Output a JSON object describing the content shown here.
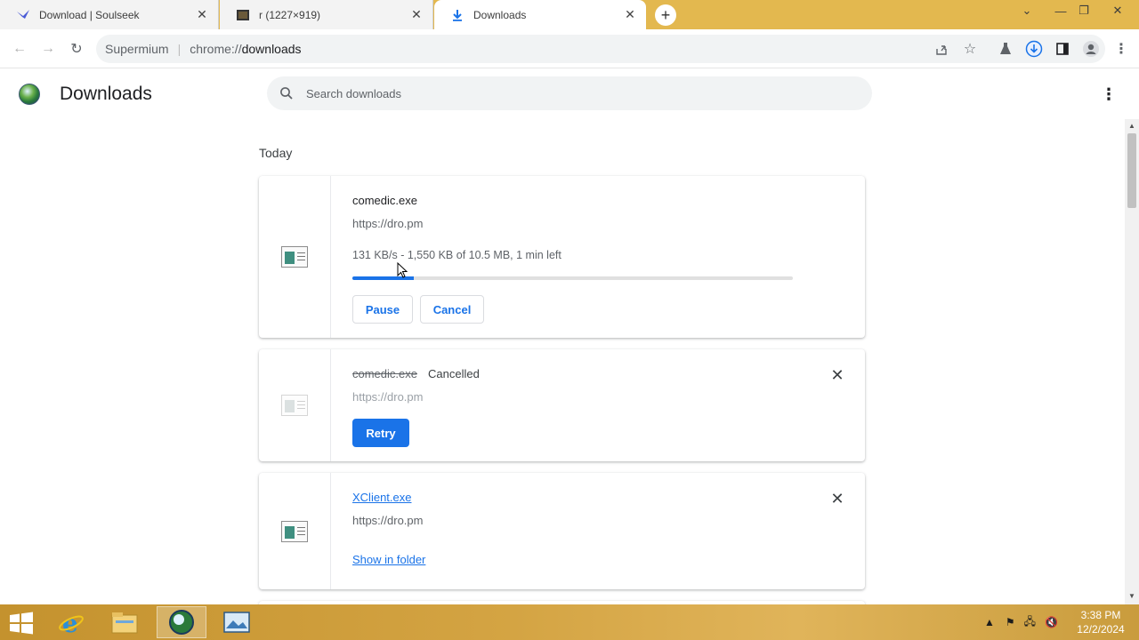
{
  "browser": {
    "tabs": [
      {
        "title": "Download | Soulseek",
        "icon": "soulseek-bird-icon"
      },
      {
        "title": "r (1227×919)",
        "icon": "image-thumbnail-icon"
      },
      {
        "title": "Downloads",
        "icon": "download-arrow-icon"
      }
    ],
    "omnibox": {
      "site_label": "Supermium",
      "url_scheme": "chrome://",
      "url_host": "downloads"
    }
  },
  "page": {
    "title": "Downloads",
    "search_placeholder": "Search downloads",
    "section_label": "Today"
  },
  "downloads": [
    {
      "file_name": "comedic.exe",
      "url": "https://dro.pm",
      "progress_text": "131 KB/s - 1,550 KB of 10.5 MB, 1 min left",
      "progress_fraction": 0.14,
      "pause_label": "Pause",
      "cancel_label": "Cancel"
    },
    {
      "file_name": "comedic.exe",
      "status": "Cancelled",
      "url": "https://dro.pm",
      "retry_label": "Retry"
    },
    {
      "file_name": "XClient.exe",
      "url": "https://dro.pm",
      "show_in_folder_label": "Show in folder"
    }
  ],
  "taskbar": {
    "clock_time": "3:38 PM",
    "clock_date": "12/2/2024"
  },
  "colors": {
    "accent": "#1a73e8",
    "tabstrip": "#e3b84f",
    "taskbar": "#d4a443"
  }
}
